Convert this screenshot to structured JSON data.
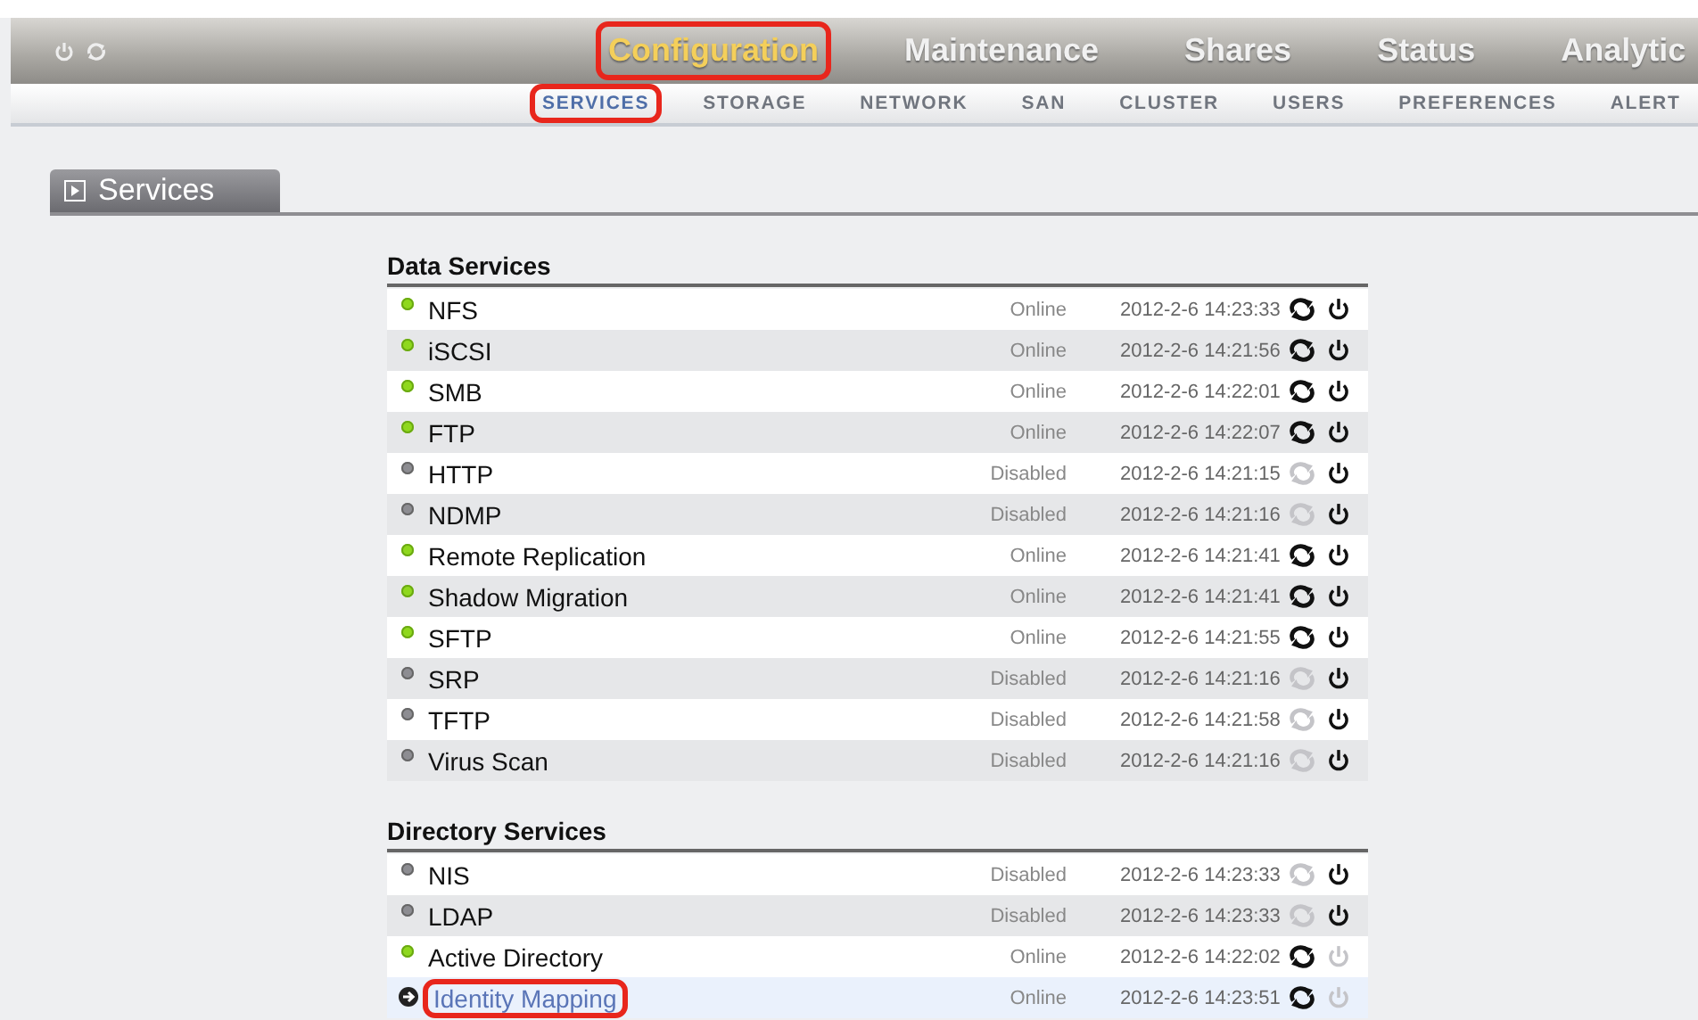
{
  "header": {
    "nav": [
      {
        "label": "Configuration",
        "selected": true,
        "annotated": true
      },
      {
        "label": "Maintenance",
        "selected": false,
        "annotated": false
      },
      {
        "label": "Shares",
        "selected": false,
        "annotated": false
      },
      {
        "label": "Status",
        "selected": false,
        "annotated": false
      },
      {
        "label": "Analytic",
        "selected": false,
        "annotated": false
      }
    ],
    "subnav": [
      {
        "label": "SERVICES",
        "selected": true,
        "annotated": true
      },
      {
        "label": "STORAGE",
        "selected": false,
        "annotated": false
      },
      {
        "label": "NETWORK",
        "selected": false,
        "annotated": false
      },
      {
        "label": "SAN",
        "selected": false,
        "annotated": false
      },
      {
        "label": "CLUSTER",
        "selected": false,
        "annotated": false
      },
      {
        "label": "USERS",
        "selected": false,
        "annotated": false
      },
      {
        "label": "PREFERENCES",
        "selected": false,
        "annotated": false
      },
      {
        "label": "ALERT",
        "selected": false,
        "annotated": false
      }
    ]
  },
  "panel": {
    "title": "Services"
  },
  "sections": [
    {
      "title": "Data Services",
      "rows": [
        {
          "name": "NFS",
          "status": "Online",
          "time": "2012-2-6 14:23:33",
          "online": true,
          "power_enabled": true,
          "selected": false,
          "annotated": false
        },
        {
          "name": "iSCSI",
          "status": "Online",
          "time": "2012-2-6 14:21:56",
          "online": true,
          "power_enabled": true,
          "selected": false,
          "annotated": false
        },
        {
          "name": "SMB",
          "status": "Online",
          "time": "2012-2-6 14:22:01",
          "online": true,
          "power_enabled": true,
          "selected": false,
          "annotated": false
        },
        {
          "name": "FTP",
          "status": "Online",
          "time": "2012-2-6 14:22:07",
          "online": true,
          "power_enabled": true,
          "selected": false,
          "annotated": false
        },
        {
          "name": "HTTP",
          "status": "Disabled",
          "time": "2012-2-6 14:21:15",
          "online": false,
          "power_enabled": true,
          "selected": false,
          "annotated": false
        },
        {
          "name": "NDMP",
          "status": "Disabled",
          "time": "2012-2-6 14:21:16",
          "online": false,
          "power_enabled": true,
          "selected": false,
          "annotated": false
        },
        {
          "name": "Remote Replication",
          "status": "Online",
          "time": "2012-2-6 14:21:41",
          "online": true,
          "power_enabled": true,
          "selected": false,
          "annotated": false
        },
        {
          "name": "Shadow Migration",
          "status": "Online",
          "time": "2012-2-6 14:21:41",
          "online": true,
          "power_enabled": true,
          "selected": false,
          "annotated": false
        },
        {
          "name": "SFTP",
          "status": "Online",
          "time": "2012-2-6 14:21:55",
          "online": true,
          "power_enabled": true,
          "selected": false,
          "annotated": false
        },
        {
          "name": "SRP",
          "status": "Disabled",
          "time": "2012-2-6 14:21:16",
          "online": false,
          "power_enabled": true,
          "selected": false,
          "annotated": false
        },
        {
          "name": "TFTP",
          "status": "Disabled",
          "time": "2012-2-6 14:21:58",
          "online": false,
          "power_enabled": true,
          "selected": false,
          "annotated": false
        },
        {
          "name": "Virus Scan",
          "status": "Disabled",
          "time": "2012-2-6 14:21:16",
          "online": false,
          "power_enabled": true,
          "selected": false,
          "annotated": false
        }
      ]
    },
    {
      "title": "Directory Services",
      "rows": [
        {
          "name": "NIS",
          "status": "Disabled",
          "time": "2012-2-6 14:23:33",
          "online": false,
          "power_enabled": true,
          "selected": false,
          "annotated": false
        },
        {
          "name": "LDAP",
          "status": "Disabled",
          "time": "2012-2-6 14:23:33",
          "online": false,
          "power_enabled": true,
          "selected": false,
          "annotated": false
        },
        {
          "name": "Active Directory",
          "status": "Online",
          "time": "2012-2-6 14:22:02",
          "online": true,
          "power_enabled": false,
          "selected": false,
          "annotated": false
        },
        {
          "name": "Identity Mapping",
          "status": "Online",
          "time": "2012-2-6 14:23:51",
          "online": true,
          "power_enabled": false,
          "selected": true,
          "annotated": true
        }
      ]
    }
  ]
}
